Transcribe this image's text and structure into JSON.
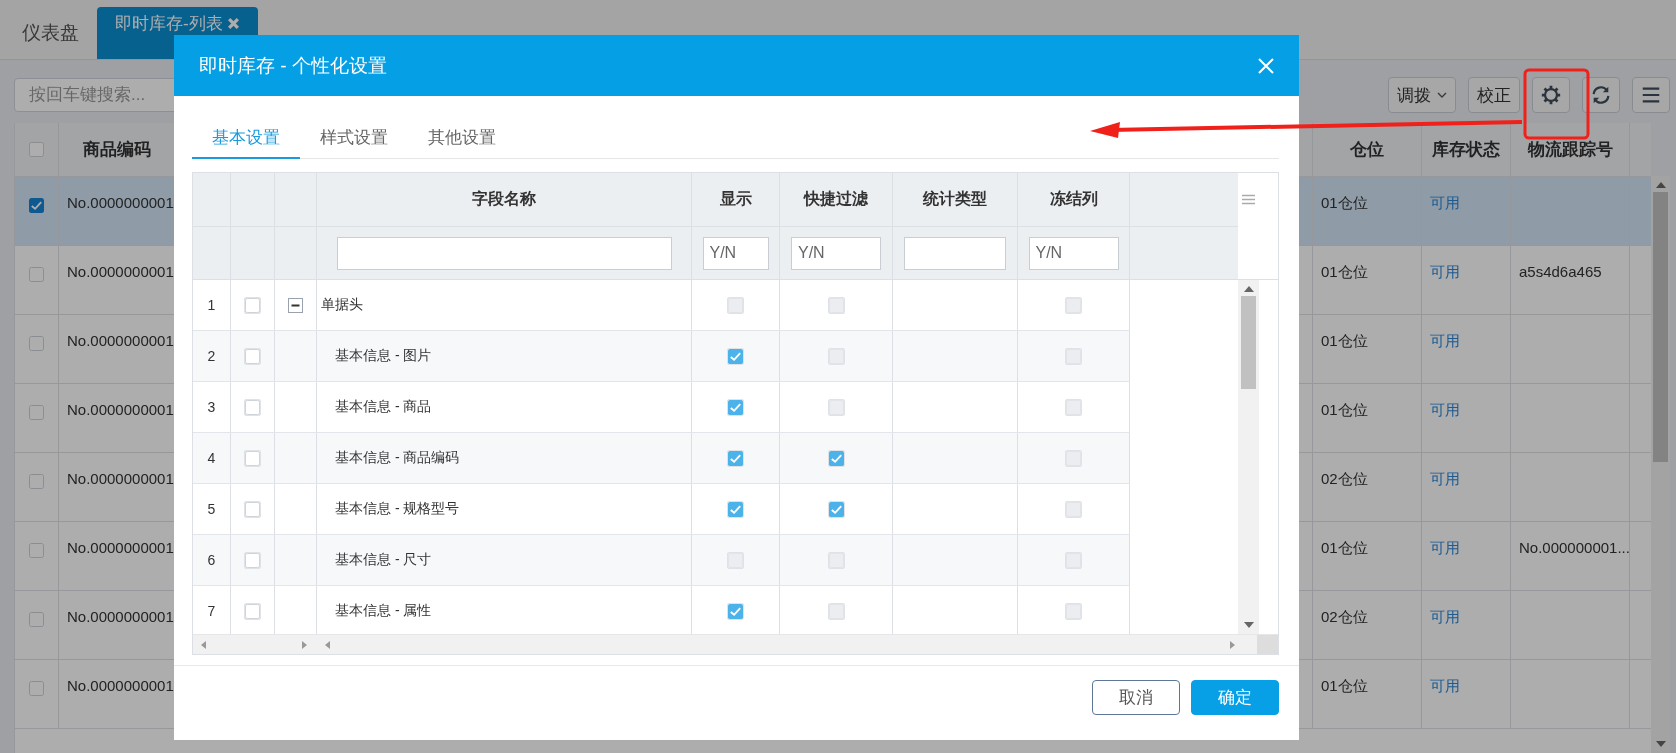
{
  "app_tabs": [
    {
      "label": "仪表盘",
      "selected": false,
      "closable": false
    },
    {
      "label": "即时库存-列表",
      "selected": true,
      "closable": true
    }
  ],
  "search": {
    "placeholder": "按回车键搜索..."
  },
  "toolbar": [
    {
      "kind": "dropdown",
      "label": "调拨"
    },
    {
      "kind": "text",
      "label": "校正"
    },
    {
      "kind": "settings"
    },
    {
      "kind": "refresh"
    },
    {
      "kind": "menu"
    }
  ],
  "table": {
    "all_checked": false,
    "left_columns": [
      "商品编码"
    ],
    "right_columns": [
      "仓位",
      "库存状态",
      "物流跟踪号"
    ],
    "rows": [
      {
        "selected": true,
        "code": "No.0000000001",
        "location": "01仓位",
        "status": "可用"
      },
      {
        "selected": false,
        "code": "No.0000000001",
        "location": "01仓位",
        "status": "可用",
        "tracking": "a5s4d6a465"
      },
      {
        "selected": false,
        "code": "No.0000000001",
        "location": "01仓位",
        "status": "可用"
      },
      {
        "selected": false,
        "code": "No.0000000001",
        "location": "01仓位",
        "status": "可用"
      },
      {
        "selected": false,
        "code": "No.0000000001",
        "location": "02仓位",
        "status": "可用"
      },
      {
        "selected": false,
        "code": "No.0000000001",
        "location": "01仓位",
        "status": "可用",
        "tracking": "No.000000001..."
      },
      {
        "selected": false,
        "code": "No.0000000001",
        "location": "02仓位",
        "status": "可用"
      },
      {
        "selected": false,
        "code": "No.0000000001",
        "location": "01仓位",
        "status": "可用"
      }
    ]
  },
  "dialog": {
    "title": "即时库存 - 个性化设置",
    "tabs": [
      {
        "label": "基本设置",
        "selected": true
      },
      {
        "label": "样式设置",
        "selected": false
      },
      {
        "label": "其他设置",
        "selected": false
      }
    ],
    "grid": {
      "columns": [
        "字段名称",
        "显示",
        "快捷过滤",
        "统计类型",
        "冻结列"
      ],
      "filters": [
        {
          "kind": "text"
        },
        {
          "kind": "text",
          "placeholder": "Y/N"
        },
        {
          "kind": "text",
          "placeholder": "Y/N"
        },
        {
          "kind": "text"
        },
        {
          "kind": "text",
          "placeholder": "Y/N"
        }
      ],
      "rows": [
        {
          "num": "1",
          "checked": false,
          "expanded": true,
          "name": "单据头",
          "show": false,
          "filter": false,
          "freeze": false,
          "children": [
            {
              "num": "2",
              "checked": false,
              "name": "基本信息 - 图片",
              "show": true,
              "filter": false,
              "freeze": false
            },
            {
              "num": "3",
              "checked": false,
              "name": "基本信息 - 商品",
              "show": true,
              "filter": false,
              "freeze": false
            },
            {
              "num": "4",
              "checked": false,
              "name": "基本信息 - 商品编码",
              "show": true,
              "filter": true,
              "freeze": false
            },
            {
              "num": "5",
              "checked": false,
              "name": "基本信息 - 规格型号",
              "show": true,
              "filter": true,
              "freeze": false
            },
            {
              "num": "6",
              "checked": false,
              "name": "基本信息 - 尺寸",
              "show": false,
              "filter": false,
              "freeze": false
            },
            {
              "num": "7",
              "checked": false,
              "name": "基本信息 - 属性",
              "show": true,
              "filter": false,
              "freeze": false
            }
          ]
        }
      ]
    },
    "buttons": [
      {
        "kind": "secondary",
        "label": "取消"
      },
      {
        "kind": "primary",
        "label": "确定"
      }
    ]
  }
}
